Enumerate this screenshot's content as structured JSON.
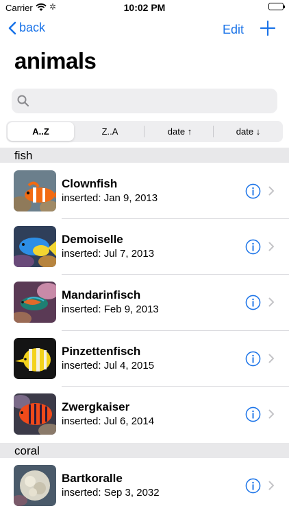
{
  "status": {
    "carrier": "Carrier",
    "time": "10:02 PM"
  },
  "nav": {
    "back_label": "back",
    "edit_label": "Edit"
  },
  "title": "animals",
  "search": {
    "placeholder": ""
  },
  "sort_options": [
    "A..Z",
    "Z..A",
    "date ↑",
    "date ↓"
  ],
  "sort_selected": "A..Z",
  "sections": [
    {
      "header": "fish",
      "items": [
        {
          "name": "Clownfish",
          "inserted": "inserted: Jan 9, 2013"
        },
        {
          "name": "Demoiselle",
          "inserted": "inserted: Jul 7, 2013"
        },
        {
          "name": "Mandarinfisch",
          "inserted": "inserted: Feb 9, 2013"
        },
        {
          "name": "Pinzettenfisch",
          "inserted": "inserted: Jul 4, 2015"
        },
        {
          "name": "Zwergkaiser",
          "inserted": "inserted: Jul 6, 2014"
        }
      ]
    },
    {
      "header": "coral",
      "items": [
        {
          "name": "Bartkoralle",
          "inserted": "inserted: Sep 3, 2032"
        }
      ]
    }
  ],
  "colors": {
    "accent": "#1a73e8",
    "section_bg": "#e8e8ea"
  }
}
